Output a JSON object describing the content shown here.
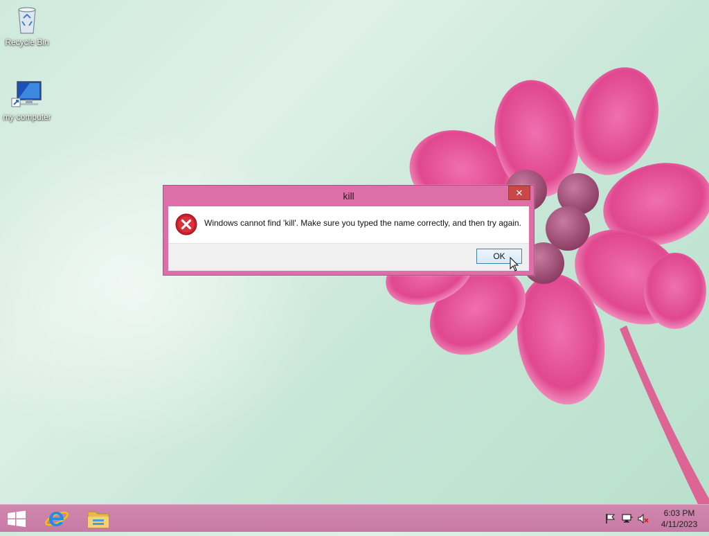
{
  "desktop": {
    "icons": [
      {
        "label": "Recycle Bin",
        "icon": "recycle-bin-icon"
      },
      {
        "label": "my computer",
        "icon": "computer-icon"
      }
    ]
  },
  "dialog": {
    "title": "kill",
    "close_label": "✕",
    "message": "Windows cannot find 'kill'. Make sure you typed the name correctly, and then try again.",
    "ok_label": "OK",
    "icon": "error-icon"
  },
  "taskbar": {
    "pinned": [
      {
        "name": "start",
        "icon": "windows-logo-icon"
      },
      {
        "name": "internet-explorer",
        "icon": "internet-explorer-icon"
      },
      {
        "name": "file-explorer",
        "icon": "folder-icon"
      }
    ],
    "tray_icons": [
      "flag-icon",
      "network-icon",
      "volume-muted-icon"
    ],
    "time": "6:03 PM",
    "date": "4/11/2023"
  },
  "colors": {
    "accent": "#dd6ea7",
    "taskbar": "#c87aa5",
    "close": "#c94747",
    "error": "#c8202a"
  }
}
